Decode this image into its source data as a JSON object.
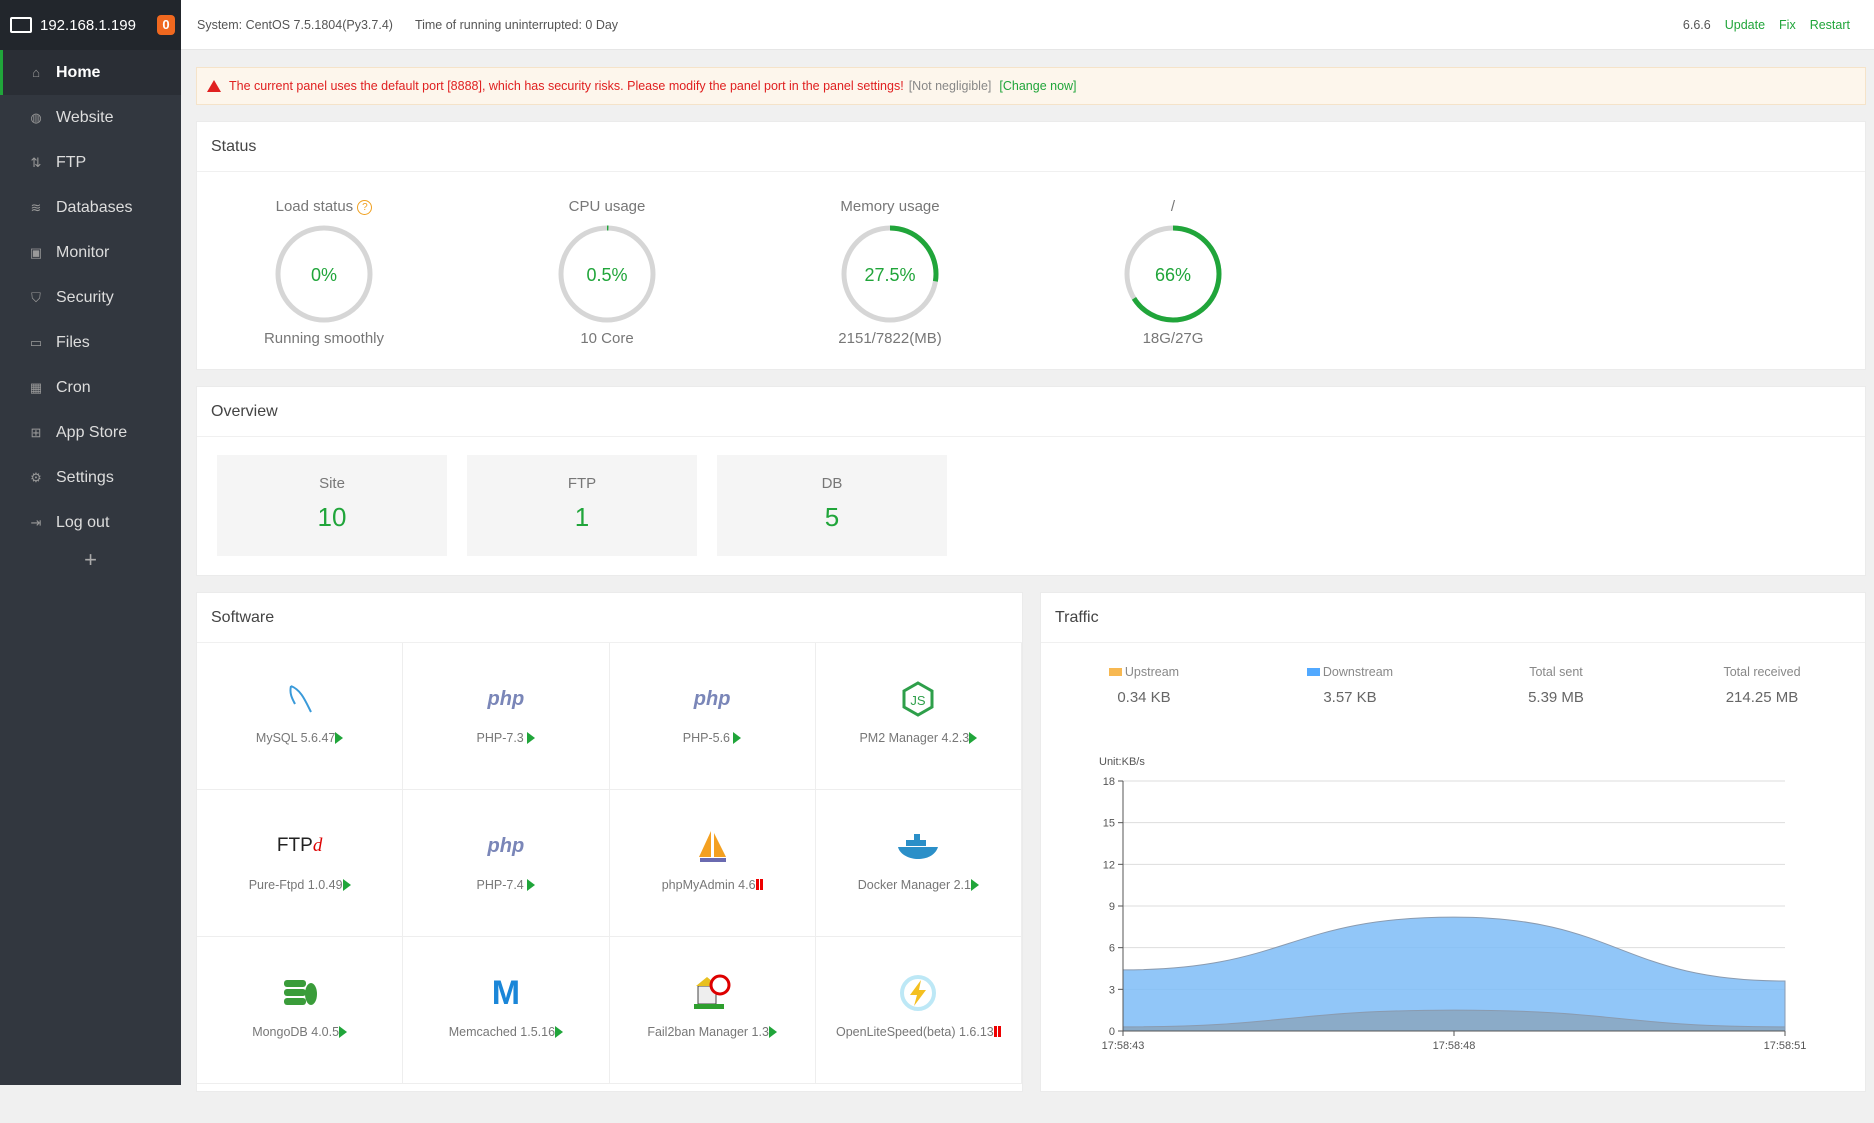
{
  "sidebar": {
    "host": "192.168.1.199",
    "badge": "0",
    "items": [
      {
        "label": "Home",
        "icon": "home-icon",
        "active": true
      },
      {
        "label": "Website",
        "icon": "globe-icon"
      },
      {
        "label": "FTP",
        "icon": "ftp-icon"
      },
      {
        "label": "Databases",
        "icon": "database-icon"
      },
      {
        "label": "Monitor",
        "icon": "monitor-icon"
      },
      {
        "label": "Security",
        "icon": "shield-icon"
      },
      {
        "label": "Files",
        "icon": "folder-icon"
      },
      {
        "label": "Cron",
        "icon": "calendar-icon"
      },
      {
        "label": "App Store",
        "icon": "grid-icon"
      },
      {
        "label": "Settings",
        "icon": "gear-icon"
      },
      {
        "label": "Log out",
        "icon": "logout-icon"
      }
    ],
    "add": "+"
  },
  "topbar": {
    "system": "System:  CentOS 7.5.1804(Py3.7.4)",
    "uptime": "Time of running uninterrupted: 0 Day",
    "version": "6.6.6",
    "update": "Update",
    "fix": "Fix",
    "restart": "Restart"
  },
  "alert": {
    "message": "The current panel uses the default port [8888], which has security risks. Please modify the panel port in the panel settings!",
    "ignore": "[Not negligible]",
    "change": "[Change now]"
  },
  "status": {
    "title": "Status",
    "gauges": [
      {
        "title": "Load status",
        "value": "0%",
        "percent": 0,
        "sub": "Running smoothly",
        "help": "?"
      },
      {
        "title": "CPU usage",
        "value": "0.5%",
        "percent": 0.5,
        "sub": "10 Core"
      },
      {
        "title": "Memory usage",
        "value": "27.5%",
        "percent": 27.5,
        "sub": "2151/7822(MB)"
      },
      {
        "title": "/",
        "value": "66%",
        "percent": 66,
        "sub": "18G/27G"
      }
    ]
  },
  "overview": {
    "title": "Overview",
    "items": [
      {
        "label": "Site",
        "value": "10"
      },
      {
        "label": "FTP",
        "value": "1"
      },
      {
        "label": "DB",
        "value": "5"
      }
    ]
  },
  "software": {
    "title": "Software",
    "items": [
      {
        "name": "MySQL 5.6.47",
        "status": "running",
        "icon": "mysql-icon"
      },
      {
        "name": "PHP-7.3 ",
        "status": "running",
        "icon": "php-icon"
      },
      {
        "name": "PHP-5.6 ",
        "status": "running",
        "icon": "php-icon"
      },
      {
        "name": "PM2 Manager 4.2.3",
        "status": "running",
        "icon": "nodejs-icon"
      },
      {
        "name": "Pure-Ftpd 1.0.49",
        "status": "running",
        "icon": "ftpd-icon"
      },
      {
        "name": "PHP-7.4 ",
        "status": "running",
        "icon": "php-icon"
      },
      {
        "name": "phpMyAdmin 4.6",
        "status": "stopped",
        "icon": "phpmyadmin-icon"
      },
      {
        "name": "Docker Manager 2.1",
        "status": "running",
        "icon": "docker-icon"
      },
      {
        "name": "MongoDB 4.0.5",
        "status": "running",
        "icon": "mongodb-icon"
      },
      {
        "name": "Memcached 1.5.16",
        "status": "running",
        "icon": "memcached-icon"
      },
      {
        "name": "Fail2ban Manager 1.3",
        "status": "running",
        "icon": "fail2ban-icon"
      },
      {
        "name": "OpenLiteSpeed(beta) 1.6.13",
        "status": "stopped",
        "icon": "openlitespeed-icon"
      }
    ]
  },
  "traffic": {
    "title": "Traffic",
    "stats": [
      {
        "label": "Upstream",
        "value": "0.34 KB",
        "color": "#f7b851"
      },
      {
        "label": "Downstream",
        "value": "3.57 KB",
        "color": "#52a9ff"
      },
      {
        "label": "Total sent",
        "value": "5.39 MB"
      },
      {
        "label": "Total received",
        "value": "214.25 MB"
      }
    ]
  },
  "chart_data": {
    "type": "area",
    "ylabel": "Unit:KB/s",
    "categories": [
      "17:58:43",
      "17:58:48",
      "17:58:51"
    ],
    "ylim": [
      0,
      18
    ],
    "yticks": [
      0,
      3,
      6,
      9,
      12,
      15,
      18
    ],
    "grid": true,
    "series": [
      {
        "name": "Downstream",
        "values": [
          4.4,
          8.2,
          3.6
        ],
        "color": "#7ebcf7"
      },
      {
        "name": "Upstream",
        "values": [
          0.3,
          1.5,
          0.3
        ],
        "color": "#8aa6c0"
      }
    ]
  }
}
